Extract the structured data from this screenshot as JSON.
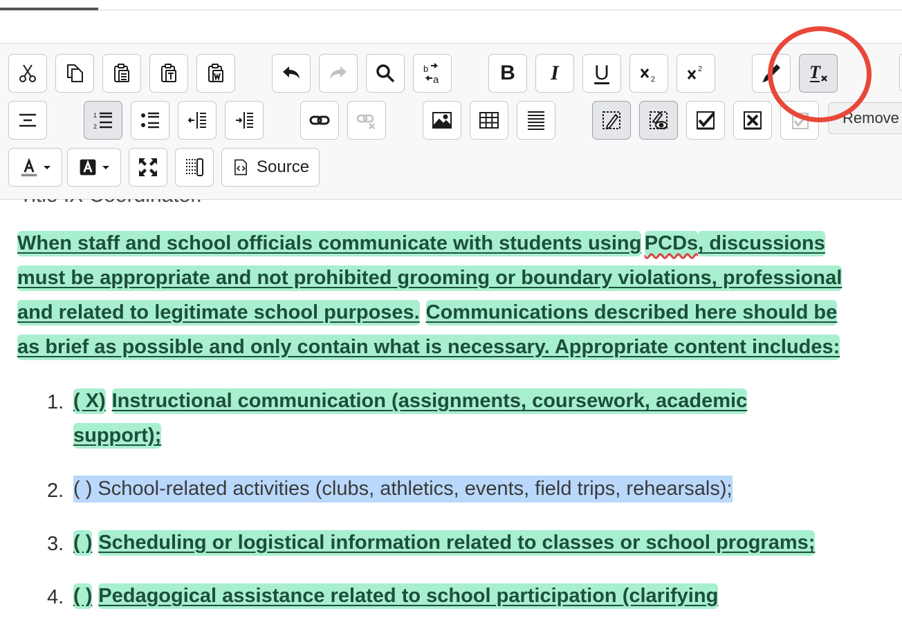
{
  "toolbar": {
    "row1": [
      {
        "name": "cut-button",
        "icon": "scissors-icon"
      },
      {
        "name": "copy-button",
        "icon": "copy-icon"
      },
      {
        "name": "paste-button",
        "icon": "paste-icon"
      },
      {
        "name": "paste-text-button",
        "icon": "paste-text-icon"
      },
      {
        "name": "paste-word-button",
        "icon": "paste-word-icon"
      },
      {
        "name": "undo-button",
        "icon": "undo-icon"
      },
      {
        "name": "redo-button",
        "icon": "redo-icon"
      },
      {
        "name": "find-button",
        "icon": "magnifier-icon"
      },
      {
        "name": "replace-button",
        "icon": "replace-icon"
      },
      {
        "name": "bold-button",
        "icon": "bold-icon"
      },
      {
        "name": "italic-button",
        "icon": "italic-icon"
      },
      {
        "name": "underline-button",
        "icon": "underline-icon"
      },
      {
        "name": "subscript-button",
        "icon": "subscript-icon"
      },
      {
        "name": "superscript-button",
        "icon": "superscript-icon"
      },
      {
        "name": "copy-formatting-button",
        "icon": "paintbrush-icon"
      },
      {
        "name": "remove-format-button",
        "icon": "remove-format-icon",
        "active": true
      }
    ],
    "row2": [
      {
        "name": "horizontal-line-button",
        "icon": "horizontal-line-icon"
      },
      {
        "name": "numbered-list-button",
        "icon": "numbered-list-icon",
        "active": true
      },
      {
        "name": "bulleted-list-button",
        "icon": "bulleted-list-icon"
      },
      {
        "name": "decrease-indent-button",
        "icon": "outdent-icon"
      },
      {
        "name": "increase-indent-button",
        "icon": "indent-icon"
      },
      {
        "name": "link-button",
        "icon": "link-icon"
      },
      {
        "name": "unlink-button",
        "icon": "unlink-icon",
        "disabled": true
      },
      {
        "name": "image-button",
        "icon": "image-icon"
      },
      {
        "name": "table-button",
        "icon": "table-icon"
      },
      {
        "name": "page-break-button",
        "icon": "page-break-icon"
      },
      {
        "name": "track-changes-button",
        "icon": "track-changes-icon",
        "active": true
      },
      {
        "name": "show-changes-button",
        "icon": "show-changes-icon",
        "active": true
      },
      {
        "name": "accept-change-button",
        "icon": "accept-change-icon"
      },
      {
        "name": "reject-change-button",
        "icon": "reject-change-icon"
      },
      {
        "name": "accept-all-button",
        "icon": "accept-all-icon",
        "disabled": true
      }
    ],
    "row3": {
      "text_color_icon": "text-color-icon",
      "background_color_icon": "background-color-icon",
      "maximize_icon": "maximize-icon",
      "show_blocks_icon": "show-blocks-icon",
      "source_label": "Source",
      "source_icon": "source-icon"
    },
    "tooltip": "Remove"
  },
  "editor": {
    "heading_clipped": "Title IX Coordinator.",
    "paragraph_lines": [
      "When staff and school officials communicate with students using",
      "PCDs",
      ", discussions",
      "must be appropriate and not prohibited grooming or boundary violations, professional",
      "and related to legitimate school purposes.",
      "Communications described here should be",
      "as brief as possible and only contain what is necessary. Appropriate content includes:"
    ],
    "list": [
      {
        "number": "1.",
        "marker": "( X)",
        "text_line1": "Instructional communication (assignments, coursework, academic",
        "text_line2": "support);"
      },
      {
        "number": "2.",
        "text": "( ) School-related activities (clubs, athletics, events, field trips, rehearsals);"
      },
      {
        "number": "3.",
        "marker": "( )",
        "text": "Scheduling or logistical information related to classes or school programs;"
      },
      {
        "number": "4.",
        "marker": "( )",
        "text": "Pedagogical assistance related to school participation (clarifying"
      }
    ]
  },
  "colors": {
    "insert_highlight": "#a8efd0",
    "selection_highlight": "#b9d8fb",
    "annotation_circle": "#e8483a"
  }
}
